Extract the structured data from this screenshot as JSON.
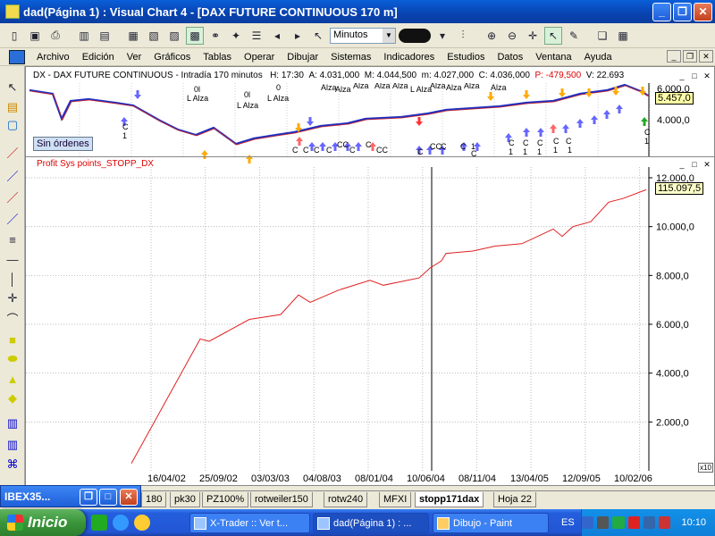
{
  "window": {
    "title": "dad(Página 1) : Visual Chart 4 - [DAX FUTURE CONTINUOUS 170 m]",
    "buttons": {
      "minimize": "_",
      "restore": "❐",
      "close": "✕"
    }
  },
  "toolbar": {
    "timeframe": "Minutos"
  },
  "menu": {
    "items": [
      "Archivo",
      "Edición",
      "Ver",
      "Gráficos",
      "Tablas",
      "Operar",
      "Dibujar",
      "Sistemas",
      "Indicadores",
      "Estudios",
      "Datos",
      "Ventana",
      "Ayuda"
    ]
  },
  "price_panel": {
    "header": "DX - DAX FUTURE CONTINUOUS - Intradía 170 minutos",
    "h_label": "H: 17:30",
    "a_label": "A: 4.031,000",
    "m_label": "M: 4.044,500",
    "m2_label": "m: 4.027,000",
    "c_label": "C: 4.036,000",
    "p_label": "P: -479,500",
    "v_label": "V: 22.693",
    "last_value": "5.457,0",
    "axis_top": "6.000,0",
    "axis_mid": "4.000,0",
    "sin_ordenes": "Sin órdenes",
    "annotations": [
      "0l",
      "L Alza",
      "0l",
      "L Alza",
      "0",
      "L Alza",
      "Alza",
      "Alza",
      "Alza",
      "Alza",
      "Alza",
      "L Alza",
      "Alza",
      "Alza",
      "Alza",
      "Alza",
      "C",
      "1",
      "C",
      "C",
      "C",
      "C",
      "CC",
      "C",
      "C",
      "CC",
      "C",
      "CC",
      "C",
      "C",
      "C",
      "1",
      "C",
      "1",
      "C",
      "1",
      "C",
      "1",
      "C",
      "1",
      "C",
      "1",
      "C",
      "1"
    ]
  },
  "profit_panel": {
    "header": "Profit Sys points_STOPP_DX",
    "last_value": "115.097,5",
    "axis_labels": [
      "12.000,0",
      "10.000,0",
      "8.000,0",
      "6.000,0",
      "4.000,0",
      "2.000,0"
    ],
    "x10_label": "x10"
  },
  "chart_data": {
    "type": "line",
    "title": "Profit Sys points_STOPP_DX",
    "xlabel": "",
    "ylabel": "",
    "x": [
      "16/04/02",
      "25/09/02",
      "03/03/03",
      "04/08/03",
      "08/01/04",
      "10/06/04",
      "08/11/04",
      "13/04/05",
      "12/09/05",
      "10/02/06"
    ],
    "x_tick_labels": [
      "16/04/02",
      "25/09/02",
      "03/03/03",
      "04/08/03",
      "08/01/04",
      "10/06/04",
      "08/11/04",
      "13/04/05",
      "12/09/05",
      "10/02/06"
    ],
    "series": [
      {
        "color": "#E02020",
        "values": [
          300,
          5400,
          6200,
          6900,
          7500,
          7900,
          8300,
          9100,
          9800,
          11000
        ],
        "last_value": 11509.75
      }
    ],
    "ylim": [
      0,
      12000
    ],
    "grid": true,
    "last_label": "115.097,5"
  },
  "tabs": [
    "180",
    "pk30",
    "PZ100%",
    "rotweiler150",
    "rotw240",
    "MFXI",
    "stopp171dax",
    "Hoja 22"
  ],
  "active_tab": "stopp171dax",
  "ibex_window": {
    "title": "IBEX35..."
  },
  "taskbar": {
    "start": "Inicio",
    "tasks": [
      "X-Trader :: Ver t...",
      "dad(Página 1) : ...",
      "Dibujo - Paint"
    ],
    "language": "ES",
    "clock": "10:10"
  }
}
